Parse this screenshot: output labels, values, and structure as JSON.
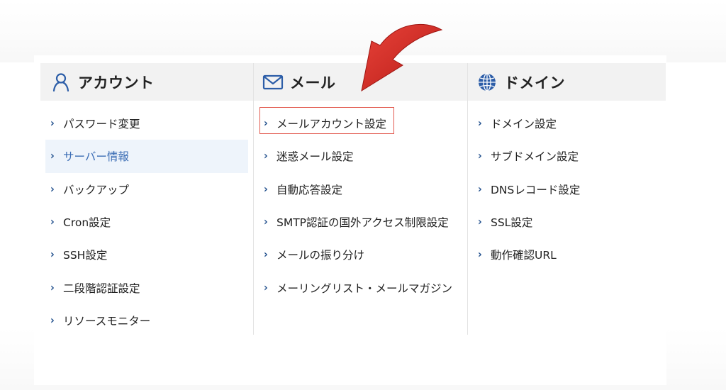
{
  "menu": {
    "columns": [
      {
        "title": "アカウント",
        "icon": "user-icon",
        "items": [
          {
            "label": "パスワード変更"
          },
          {
            "label": "サーバー情報",
            "active": true
          },
          {
            "label": "バックアップ"
          },
          {
            "label": "Cron設定"
          },
          {
            "label": "SSH設定"
          },
          {
            "label": "二段階認証設定"
          },
          {
            "label": "リソースモニター"
          }
        ]
      },
      {
        "title": "メール",
        "icon": "mail-icon",
        "items": [
          {
            "label": "メールアカウント設定",
            "highlighted": true
          },
          {
            "label": "迷惑メール設定"
          },
          {
            "label": "自動応答設定"
          },
          {
            "label": "SMTP認証の国外アクセス制限設定"
          },
          {
            "label": "メールの振り分け"
          },
          {
            "label": "メーリングリスト・メールマガジン"
          }
        ]
      },
      {
        "title": "ドメイン",
        "icon": "globe-icon",
        "items": [
          {
            "label": "ドメイン設定"
          },
          {
            "label": "サブドメイン設定"
          },
          {
            "label": "DNSレコード設定"
          },
          {
            "label": "SSL設定"
          },
          {
            "label": "動作確認URL"
          }
        ]
      }
    ]
  },
  "colors": {
    "header_bg": "#f2f2f2",
    "chevron": "#1f4e8c",
    "active_text": "#3a6cb4",
    "active_bg": "#eef4fb",
    "highlight_border": "#e25a4f",
    "arrow": "#d42a22"
  },
  "chevron_glyph": "›"
}
